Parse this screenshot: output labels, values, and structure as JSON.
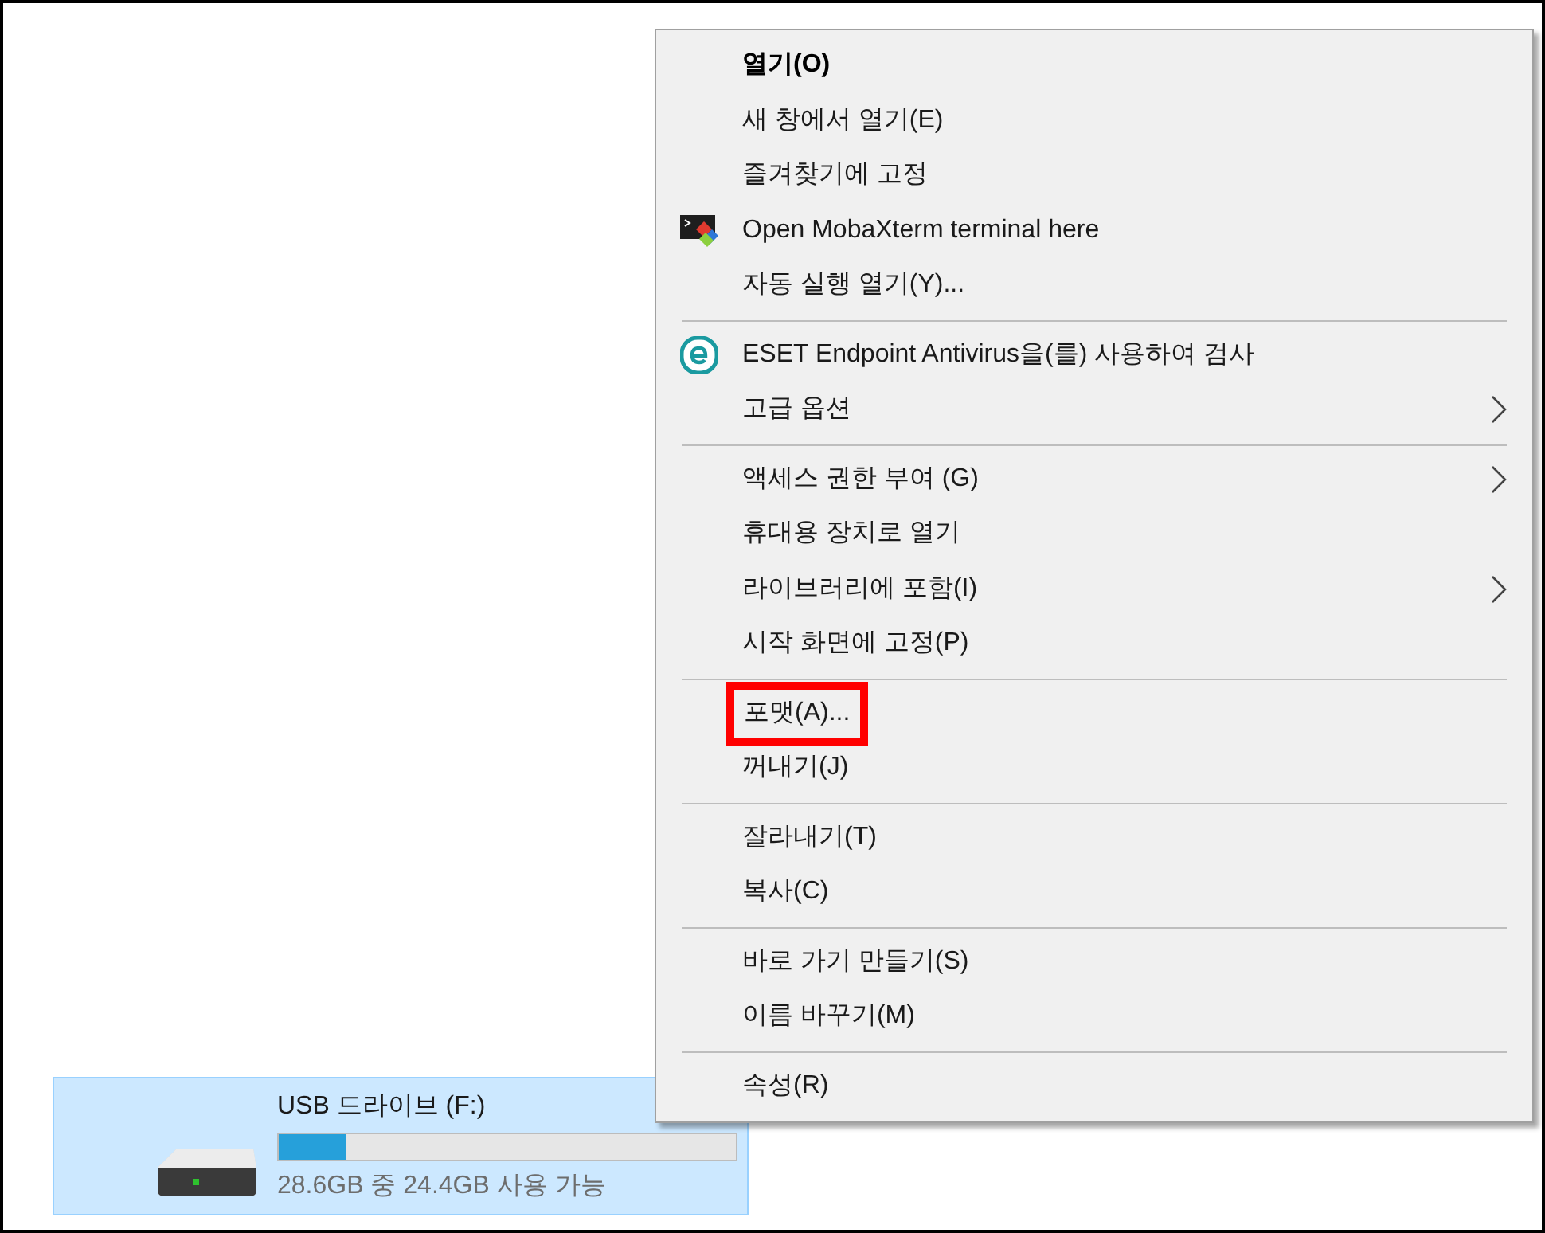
{
  "context_menu": {
    "groups": [
      {
        "items": [
          {
            "label": "열기(O)",
            "default": true
          },
          {
            "label": "새 창에서 열기(E)"
          },
          {
            "label": "즐겨찾기에 고정"
          },
          {
            "label": "Open MobaXterm terminal here",
            "kind": "terminal"
          },
          {
            "label": "자동 실행 열기(Y)..."
          }
        ]
      },
      {
        "items": [
          {
            "label": "ESET Endpoint Antivirus을(를) 사용하여 검사",
            "kind": "scanner"
          },
          {
            "label": "고급 옵션",
            "submenu": true
          }
        ]
      },
      {
        "items": [
          {
            "label": "액세스 권한 부여 (G)",
            "submenu": true
          },
          {
            "label": "휴대용 장치로 열기"
          },
          {
            "label": "라이브러리에 포함(I)",
            "submenu": true
          },
          {
            "label": "시작 화면에 고정(P)"
          }
        ]
      },
      {
        "items": [
          {
            "label": "포맷(A)...",
            "highlighted": true
          },
          {
            "label": "꺼내기(J)"
          }
        ]
      },
      {
        "items": [
          {
            "label": "잘라내기(T)"
          },
          {
            "label": "복사(C)"
          }
        ]
      },
      {
        "items": [
          {
            "label": "바로 가기 만들기(S)"
          },
          {
            "label": "이름 바꾸기(M)"
          }
        ]
      },
      {
        "items": [
          {
            "label": "속성(R)"
          }
        ]
      }
    ]
  },
  "drive": {
    "name": "USB 드라이브 (F:)",
    "level": 0.147,
    "space": "28.6GB 중 24.4GB 사용 가능",
    "selected": true
  }
}
